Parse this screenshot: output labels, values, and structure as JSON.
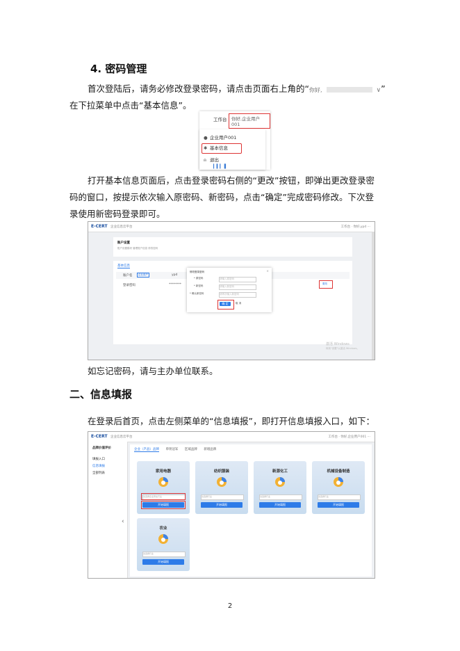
{
  "section4": {
    "heading": "4. 密码管理",
    "para1_line1": "首次登陆后，请务必修改登录密码，请点击页面右上角的“",
    "para1_inline_user": "你好,",
    "para1_inline_arrow": "∨",
    "para1_tail": "”",
    "para1_line2": "在下拉菜单中点击“基本信息”。",
    "para2_line1": "打开基本信息页面后，点击登录密码右侧的“更改”按钮，即弹出更改登录密",
    "para2_line2": "码的窗口，按提示依次输入原密码、新密码，点击“确定”完成密码修改。下次登",
    "para2_line3": "录使用新密码登录即可。",
    "para3": "如忘记密码，请与主办单位联系。"
  },
  "section2": {
    "heading": "二、信息填报",
    "para1": "在登录后首页，点击左侧菜单的“信息填报”，即打开信息填报入口，如下："
  },
  "page_number": "2",
  "shot1": {
    "workspace": "工作台",
    "user_chip": "你好,企业用户001",
    "menu": [
      {
        "icon": "user-icon",
        "label": "企业用户001"
      },
      {
        "icon": "gear-icon",
        "label": "基本信息"
      },
      {
        "icon": "logout-icon",
        "label": "退出"
      }
    ]
  },
  "shot2": {
    "logo": "E-CERT",
    "logo_sub": "企业信息云平台",
    "header_right": "工作台 · 你好,ypd ···",
    "card_title": "账户设置",
    "card_desc": "账户设置模块 管理账户信息 修改密码",
    "tab": "基本信息",
    "rows": [
      {
        "label": "账户名",
        "badge": "企业用户",
        "value": "ypd"
      },
      {
        "label": "登录密码",
        "value": "********",
        "action": "更改"
      }
    ],
    "modal_title": "修改登录密码",
    "modal_fields": [
      {
        "label": "* 原密码",
        "placeholder": "请输入原密码"
      },
      {
        "label": "* 新密码",
        "placeholder": "请输入新密码"
      },
      {
        "label": "* 确认新密码",
        "placeholder": "请再次输入新密码"
      }
    ],
    "ok": "确 定",
    "cancel": "取 消",
    "watermark1": "激活 Windows",
    "watermark2": "转到\"设置\"以激活 Windows。"
  },
  "shot3": {
    "logo": "E-CERT",
    "logo_sub": "企业信息云平台",
    "header_right": "工作台 · 你好,企业用户001 ···",
    "side_title": "品牌价值评价",
    "side_items": [
      "填报入口",
      "信息填报",
      "全部列表"
    ],
    "tabs": [
      "企业（产品）品牌",
      "单项冠军",
      "区域品牌",
      "新增品牌"
    ],
    "categories": [
      {
        "title": "家用电器",
        "placeholder": "请选择企业所在行业",
        "button": "开始填报"
      },
      {
        "title": "纺织服装",
        "placeholder": "请选择行业",
        "button": "开始填报"
      },
      {
        "title": "新源化工",
        "placeholder": "请选择行业",
        "button": "开始填报"
      },
      {
        "title": "机械设备制造",
        "placeholder": "请选择行业",
        "button": "开始填报"
      },
      {
        "title": "农业",
        "placeholder": "请选择行业",
        "button": "开始填报"
      }
    ],
    "collapse_glyph": "‹"
  },
  "colors": {
    "accent": "#2d7be8",
    "highlight": "#dd3333",
    "logo": "#1a4fa0"
  }
}
